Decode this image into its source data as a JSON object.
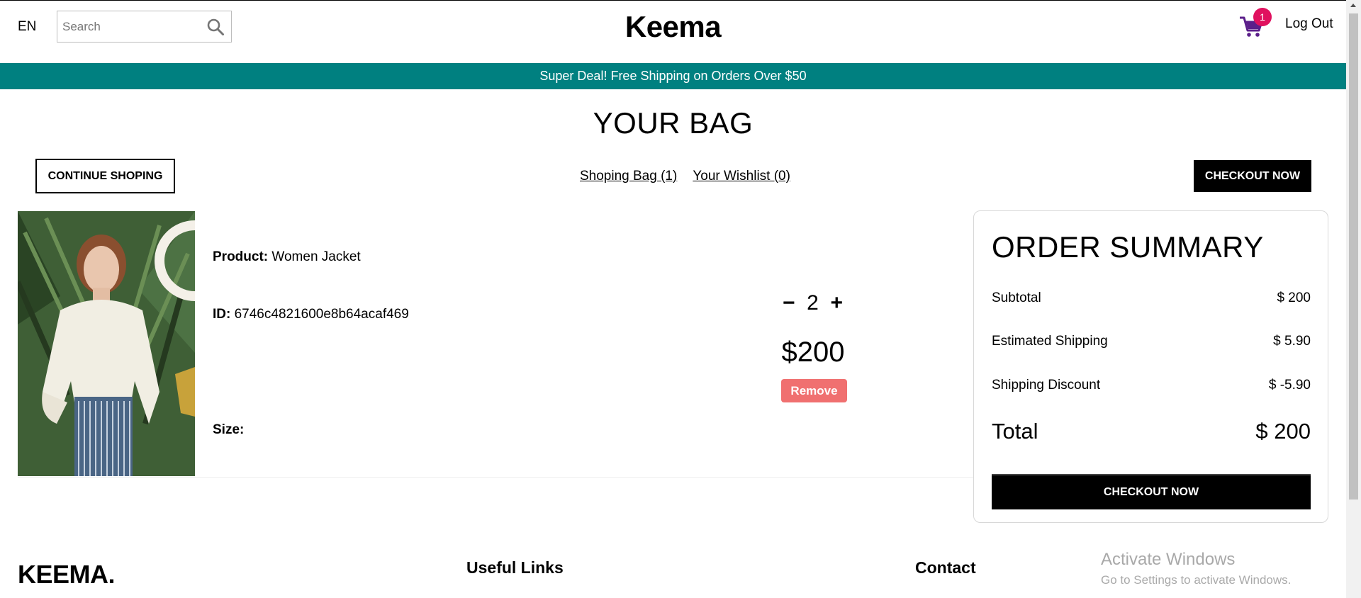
{
  "nav": {
    "language": "EN",
    "search_placeholder": "Search",
    "logo": "Keema",
    "cart_count": "1",
    "logout_label": "Log Out"
  },
  "announcement": "Super Deal! Free Shipping on Orders Over $50",
  "bag": {
    "title": "YOUR BAG",
    "continue_label": "CONTINUE SHOPING",
    "shopping_bag_link": "Shoping Bag (1)",
    "wishlist_link": "Your Wishlist (0)",
    "checkout_label": "CHECKOUT NOW"
  },
  "product": {
    "name_label": "Product:",
    "name": "Women Jacket",
    "id_label": "ID:",
    "id": "6746c4821600e8b64acaf469",
    "size_label": "Size:",
    "quantity": "2",
    "minus": "−",
    "plus": "+",
    "price": "$200",
    "remove_label": "Remove"
  },
  "summary": {
    "title": "ORDER SUMMARY",
    "subtotal_label": "Subtotal",
    "subtotal": "$ 200",
    "shipping_label": "Estimated Shipping",
    "shipping": "$ 5.90",
    "discount_label": "Shipping Discount",
    "discount": "$ -5.90",
    "total_label": "Total",
    "total": "$ 200",
    "checkout_label": "CHECKOUT NOW"
  },
  "footer": {
    "logo": "KEEMA.",
    "useful_links": "Useful Links",
    "contact": "Contact"
  },
  "watermark": {
    "title": "Activate Windows",
    "subtitle": "Go to Settings to activate Windows."
  },
  "colors": {
    "announcement_bg": "#008080",
    "badge": "#e0115f",
    "remove_bg": "#f07070"
  },
  "icons": [
    "search-icon",
    "cart-icon"
  ]
}
